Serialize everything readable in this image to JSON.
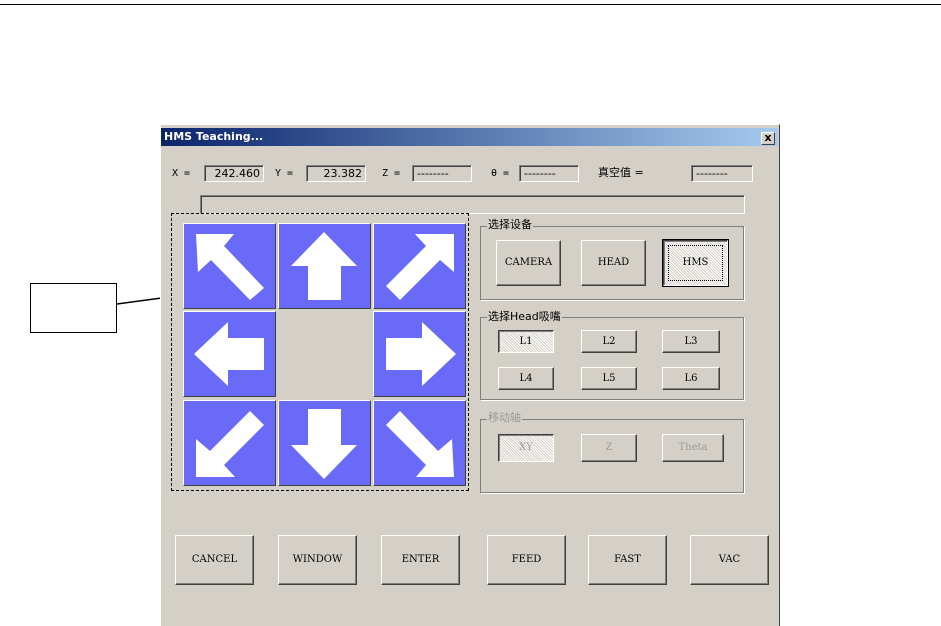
{
  "dialog": {
    "title": "HMS Teaching...",
    "close_label": "x"
  },
  "coords": {
    "x_label": "X =",
    "x_value": "242.460",
    "y_label": "Y =",
    "y_value": "23.382",
    "z_label": "Z =",
    "z_value": "--------",
    "theta_label": "θ =",
    "theta_value": "--------",
    "vacuum_label": "真空值 =",
    "vacuum_value": "--------"
  },
  "dpad": {
    "buttons": [
      "up-left",
      "up",
      "up-right",
      "left",
      "right",
      "down-left",
      "down",
      "down-right"
    ],
    "color": "#6a6af8"
  },
  "device_group": {
    "title": "选择设备",
    "buttons": [
      "CAMERA",
      "HEAD",
      "HMS"
    ],
    "selected": "HMS"
  },
  "nozzle_group": {
    "title": "选择Head吸嘴",
    "buttons": [
      "L1",
      "L2",
      "L3",
      "L4",
      "L5",
      "L6"
    ],
    "selected": "L1"
  },
  "axis_group": {
    "title": "移动轴",
    "buttons": [
      "XY",
      "Z",
      "Theta"
    ],
    "selected": "XY"
  },
  "bottom_buttons": [
    "CANCEL",
    "WINDOW",
    "ENTER",
    "FEED",
    "FAST",
    "VAC"
  ]
}
